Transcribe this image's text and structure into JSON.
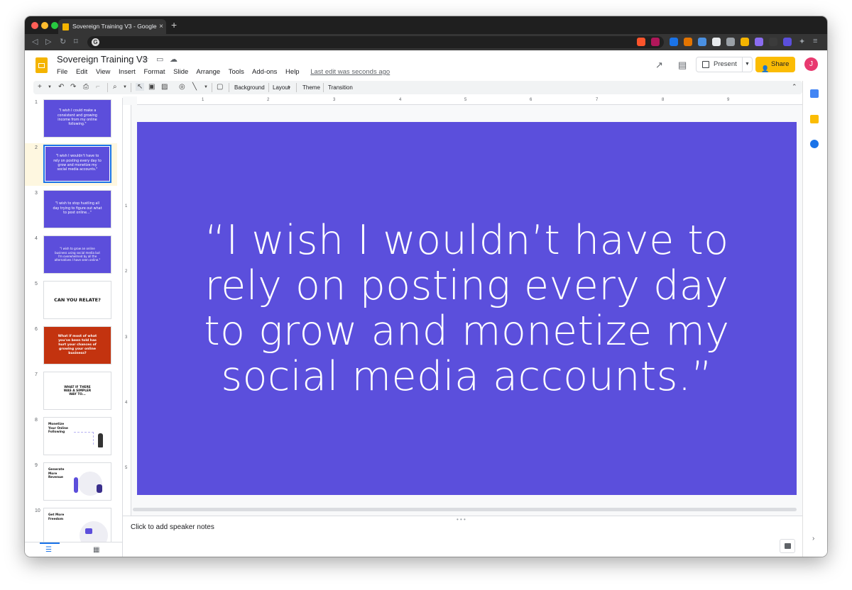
{
  "browser": {
    "tab_title": "Sovereign Training V3 - Google",
    "tab_close": "×",
    "new_tab": "+"
  },
  "doc": {
    "title": "Sovereign Training V3",
    "menus": [
      "File",
      "Edit",
      "View",
      "Insert",
      "Format",
      "Slide",
      "Arrange",
      "Tools",
      "Add-ons",
      "Help"
    ],
    "last_edit": "Last edit was seconds ago"
  },
  "header": {
    "present_label": "Present",
    "share_label": "Share",
    "avatar_initial": "J"
  },
  "toolbar": {
    "background": "Background",
    "layout": "Layout",
    "theme": "Theme",
    "transition": "Transition"
  },
  "ruler": {
    "h_ticks": [
      "1",
      "2",
      "3",
      "4",
      "5",
      "6",
      "7",
      "8",
      "9"
    ],
    "v_ticks": [
      "1",
      "2",
      "3",
      "4",
      "5"
    ]
  },
  "slides": [
    {
      "num": "1",
      "style": "purple",
      "text": "\"I wish I could make a consistent and growing income from my online following.\""
    },
    {
      "num": "2",
      "style": "purple",
      "text": "\"I wish I wouldn't have to rely on posting every day to grow and monetize my social media accounts.\""
    },
    {
      "num": "3",
      "style": "purple",
      "text": "\"I wish to stop hustling all day trying to figure out what to post online...\""
    },
    {
      "num": "4",
      "style": "purple",
      "text": "\"I wish to grow an online business using social media but I'm overwhelmed by all the alternatives I have seen online.\""
    },
    {
      "num": "5",
      "style": "white",
      "text": "CAN YOU RELATE?"
    },
    {
      "num": "6",
      "style": "red",
      "text": "What if most of what you've been told has hurt your chances of growing your online business?"
    },
    {
      "num": "7",
      "style": "white-small",
      "text": "WHAT IF THERE WAS A SIMPLER WAY TO..."
    },
    {
      "num": "8",
      "style": "illus",
      "text": "Monetize Your Online Following"
    },
    {
      "num": "9",
      "style": "illus",
      "text": "Generate More Revenue"
    },
    {
      "num": "10",
      "style": "illus",
      "text": "Get More Freedom"
    }
  ],
  "current_slide": {
    "text": "“I wish I wouldn’t have to rely on posting every day to grow and monetize my social media accounts.”",
    "background": "#5b4fdc"
  },
  "notes": {
    "placeholder": "Click to add speaker notes"
  }
}
